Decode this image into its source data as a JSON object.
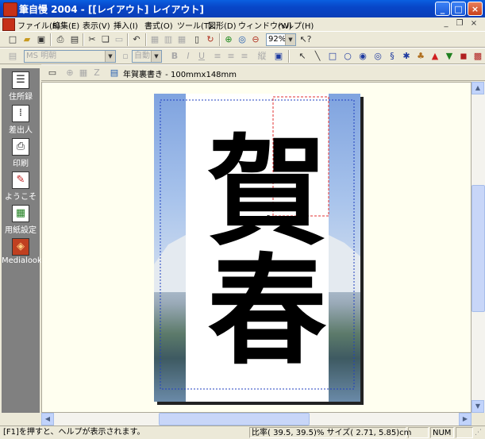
{
  "window": {
    "title": "筆自慢 2004 - [[レイアウト] レイアウト]"
  },
  "menu": {
    "items": [
      "ファイル(F)",
      "編集(E)",
      "表示(V)",
      "挿入(I)",
      "書式(O)",
      "ツール(T)",
      "図形(D)",
      "ウィンドウ(W)",
      "ヘルプ(H)"
    ]
  },
  "toolbar": {
    "zoom": "92%"
  },
  "format_toolbar": {
    "font_name": "MS 明朝",
    "font_size": "自動"
  },
  "layout_toolbar": {
    "template_label": "年賀裏書き - 100mmx148mm"
  },
  "left_panel": {
    "items": [
      {
        "label": "住所録",
        "icon": "address-book-icon"
      },
      {
        "label": "差出人",
        "icon": "sender-icon"
      },
      {
        "label": "印刷",
        "icon": "printer-icon"
      },
      {
        "label": "ようこそ",
        "icon": "welcome-icon"
      },
      {
        "label": "用紙設定",
        "icon": "paper-setup-icon"
      },
      {
        "label": "Medialook",
        "icon": "medialook-icon"
      }
    ]
  },
  "card": {
    "calligraphy": "賀春"
  },
  "status": {
    "help": "[F1]を押すと、ヘルプが表示されます。",
    "coords": "比率( 39.5, 39.5)% サイズ( 2.71, 5.85)cm",
    "num": "NUM"
  },
  "colors": {
    "title_bar": "#0846C8",
    "left_panel": "#808080",
    "work_bg": "#FFFFF0",
    "selection": "#E03030",
    "guide": "#2040C0"
  }
}
